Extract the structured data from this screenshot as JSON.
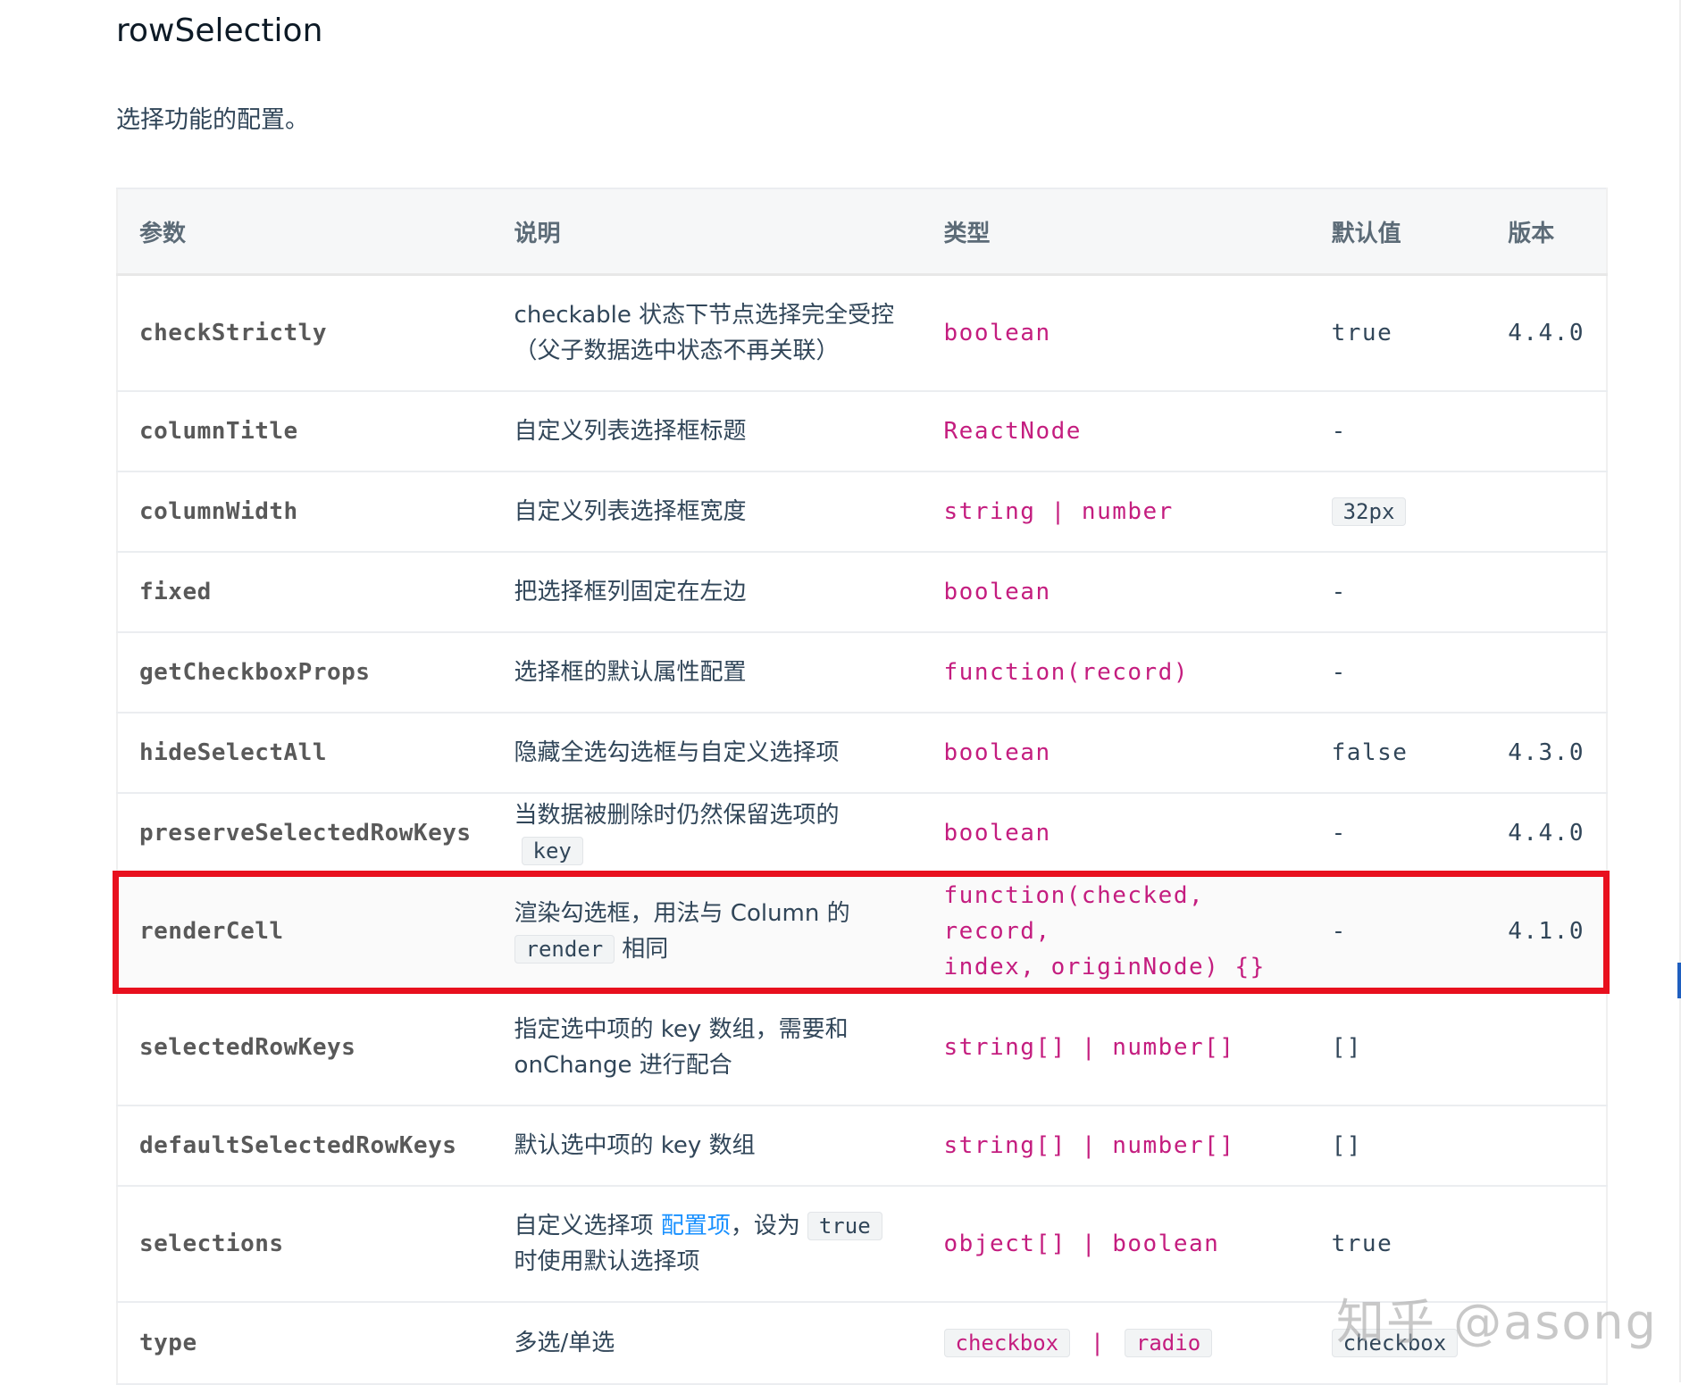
{
  "page": {
    "title": "rowSelection",
    "description": "选择功能的配置。"
  },
  "table": {
    "headers": {
      "param": "参数",
      "desc": "说明",
      "type": "类型",
      "default": "默认值",
      "version": "版本"
    },
    "rows": [
      {
        "param": "checkStrictly",
        "desc_1": "checkable 状态下节点选择完全受控",
        "desc_2": "（父子数据选中状态不再关联）",
        "type": "boolean",
        "default": "true",
        "version": "4.4.0"
      },
      {
        "param": "columnTitle",
        "desc": "自定义列表选择框标题",
        "type": "ReactNode",
        "default": "-",
        "version": ""
      },
      {
        "param": "columnWidth",
        "desc": "自定义列表选择框宽度",
        "type": "string | number",
        "default": "32px",
        "version": ""
      },
      {
        "param": "fixed",
        "desc": "把选择框列固定在左边",
        "type": "boolean",
        "default": "-",
        "version": ""
      },
      {
        "param": "getCheckboxProps",
        "desc": "选择框的默认属性配置",
        "type": "function(record)",
        "default": "-",
        "version": ""
      },
      {
        "param": "hideSelectAll",
        "desc": "隐藏全选勾选框与自定义选择项",
        "type": "boolean",
        "default": "false",
        "version": "4.3.0"
      },
      {
        "param": "preserveSelectedRowKeys",
        "desc": "当数据被删除时仍然保留选项的",
        "desc_code": "key",
        "type": "boolean",
        "default": "-",
        "version": "4.4.0"
      },
      {
        "param": "renderCell",
        "desc_1": "渲染勾选框，用法与 Column 的",
        "desc_code": "render",
        "desc_2": "相同",
        "type_1": "function(checked, record,",
        "type_2": "index, originNode) {}",
        "default": "-",
        "version": "4.1.0"
      },
      {
        "param": "selectedRowKeys",
        "desc_1": "指定选中项的 key 数组，需要和",
        "desc_2": "onChange 进行配合",
        "type": "string[] | number[]",
        "default": "[]",
        "version": ""
      },
      {
        "param": "defaultSelectedRowKeys",
        "desc": "默认选中项的 key 数组",
        "type": "string[] | number[]",
        "default": "[]",
        "version": ""
      },
      {
        "param": "selections",
        "desc_1": "自定义选择项",
        "desc_link": "配置项",
        "desc_mid": "，设为",
        "desc_code": "true",
        "desc_2": "时使用默认选择项",
        "type": "object[] | boolean",
        "default": "true",
        "version": ""
      },
      {
        "param": "type",
        "desc": "多选/单选",
        "type_opt1": "checkbox",
        "type_sep": "|",
        "type_opt2": "radio",
        "default": "checkbox",
        "version": ""
      }
    ]
  },
  "watermark": "知乎 @asong",
  "colors": {
    "type": "#c41d7f",
    "link": "#1890ff",
    "highlight_border": "#e8101e"
  }
}
